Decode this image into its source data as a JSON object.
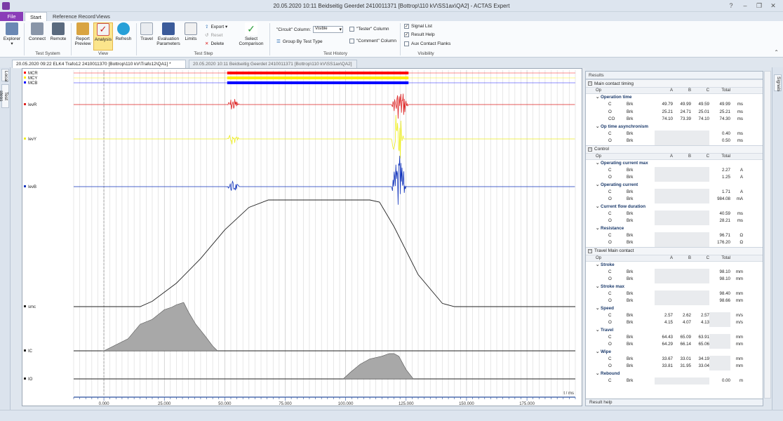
{
  "window": {
    "title": "20.05.2020 10:11 Beidseitig Geerdet 2410011371 [Bottrop\\110 kV\\SS1ax\\QA2] - ACTAS Expert"
  },
  "ribbon_tabs": [
    "File",
    "Start",
    "Reference Record",
    "Views"
  ],
  "ribbon": {
    "explorer": "Explorer",
    "connect": "Connect",
    "remote": "Remote",
    "report_preview": "Report Preview",
    "analysis": "Analysis",
    "refresh": "Refresh",
    "travel": "Travel",
    "evaluation_parameters": "Evaluation Parameters",
    "limits": "Limits",
    "export": "Export ▾",
    "reset": "Reset",
    "delete": "Delete",
    "select_comparison": "Select Comparison",
    "circuit_column_label": "\"Circuit\" Column:",
    "circuit_column_value": "Visible",
    "tester_column": "\"Tester\" Column",
    "group_by_test_type": "Group By Test Type",
    "comment_column": "\"Comment\" Column",
    "signal_list": "Signal List",
    "result_help": "Result Help",
    "aux_contact_flanks": "Aux Contact Flanks",
    "groups": [
      "Test System",
      "View",
      "Test Step",
      "Test History",
      "Visibility"
    ]
  },
  "side_tabs": {
    "left": [
      "Local",
      "Test steps"
    ],
    "right": [
      "Signals"
    ]
  },
  "doc_tabs": [
    "20.05.2020 09:22 ELK4 Trafo12 2410011370 [Bottrop\\110 kV\\Trafo12\\QA1] *",
    "20.05.2020 10:11 Beidseitig Geerdet 2410011371 [Bottrop\\110 kV\\SS1ax\\QA2]"
  ],
  "chart_data": {
    "type": "line",
    "xlabel": "t / ms",
    "x_ticks": [
      "0.000",
      "25.000",
      "50.000",
      "75.000",
      "100.000",
      "125.000",
      "150.000",
      "175.000"
    ],
    "xlim": [
      -12.5,
      195
    ],
    "series": [
      {
        "name": "MCR",
        "color": "#ff0000",
        "type": "bar",
        "on": [
          51,
          126
        ]
      },
      {
        "name": "MCY",
        "color": "#ffee00",
        "type": "bar",
        "on": [
          51,
          126
        ]
      },
      {
        "name": "MCB",
        "color": "#0000ff",
        "type": "bar",
        "on": [
          51,
          126
        ]
      },
      {
        "name": "IevR",
        "color": "#dd2222"
      },
      {
        "name": "IevY",
        "color": "#eeee22"
      },
      {
        "name": "IevB",
        "color": "#1133bb"
      },
      {
        "name": "smc",
        "color": "#222222",
        "x": [
          -12.5,
          15,
          20,
          30,
          40,
          50,
          60,
          68,
          80,
          100,
          110,
          114,
          120,
          130,
          140,
          145,
          195
        ],
        "y": [
          0,
          0,
          0.05,
          0.22,
          0.45,
          0.72,
          0.93,
          1.0,
          1.0,
          1.0,
          1.0,
          0.98,
          0.75,
          0.3,
          0.03,
          0,
          0
        ]
      },
      {
        "name": "IC",
        "color": "#222222",
        "x": [
          0,
          10,
          15,
          20,
          25,
          28,
          30,
          33,
          35,
          38,
          42,
          45,
          47,
          -1
        ],
        "y": [
          0,
          0.25,
          0.55,
          0.65,
          0.85,
          0.9,
          0.95,
          1.0,
          0.8,
          0.55,
          0.3,
          0.1,
          0,
          0
        ]
      },
      {
        "name": "IO",
        "color": "#222222",
        "x": [
          99,
          102,
          106,
          110,
          115,
          118,
          120,
          122,
          125,
          128
        ],
        "y": [
          0,
          0.25,
          0.55,
          0.75,
          0.85,
          0.95,
          0.95,
          0.85,
          0.35,
          0
        ]
      }
    ]
  },
  "results": {
    "title": "Results",
    "footer": "Result help",
    "columns": [
      "Op",
      "A",
      "B",
      "C",
      "Total"
    ],
    "sections": [
      {
        "name": "Main contact timing",
        "groups": [
          {
            "name": "Operation time",
            "rows": [
              {
                "op": "C",
                "type": "Brk",
                "a": "49.79",
                "b": "49.99",
                "c": "49.59",
                "total": "49.99",
                "unit": "ms"
              },
              {
                "op": "O",
                "type": "Brk",
                "a": "25.21",
                "b": "24.71",
                "c": "25.01",
                "total": "25.21",
                "unit": "ms"
              },
              {
                "op": "CO",
                "type": "Brk",
                "a": "74.10",
                "b": "73.39",
                "c": "74.10",
                "total": "74.30",
                "unit": "ms"
              }
            ]
          },
          {
            "name": "Op time asynchronism",
            "rows": [
              {
                "op": "C",
                "type": "Brk",
                "a": "",
                "b": "",
                "c": "",
                "total": "0.40",
                "unit": "ms"
              },
              {
                "op": "O",
                "type": "Brk",
                "a": "",
                "b": "",
                "c": "",
                "total": "0.50",
                "unit": "ms"
              }
            ]
          }
        ]
      },
      {
        "name": "Control",
        "groups": [
          {
            "name": "Operating current max",
            "rows": [
              {
                "op": "C",
                "type": "Brk",
                "a": "",
                "b": "",
                "c": "",
                "total": "2.27",
                "unit": "A"
              },
              {
                "op": "O",
                "type": "Brk",
                "a": "",
                "b": "",
                "c": "",
                "total": "1.25",
                "unit": "A"
              }
            ]
          },
          {
            "name": "Operating current",
            "rows": [
              {
                "op": "C",
                "type": "Brk",
                "a": "",
                "b": "",
                "c": "",
                "total": "1.71",
                "unit": "A"
              },
              {
                "op": "O",
                "type": "Brk",
                "a": "",
                "b": "",
                "c": "",
                "total": "984.08",
                "unit": "mA"
              }
            ]
          },
          {
            "name": "Current flow duration",
            "rows": [
              {
                "op": "C",
                "type": "Brk",
                "a": "",
                "b": "",
                "c": "",
                "total": "40.59",
                "unit": "ms"
              },
              {
                "op": "O",
                "type": "Brk",
                "a": "",
                "b": "",
                "c": "",
                "total": "28.21",
                "unit": "ms"
              }
            ]
          },
          {
            "name": "Resistance",
            "rows": [
              {
                "op": "C",
                "type": "Brk",
                "a": "",
                "b": "",
                "c": "",
                "total": "96.71",
                "unit": "Ω"
              },
              {
                "op": "O",
                "type": "Brk",
                "a": "",
                "b": "",
                "c": "",
                "total": "176.20",
                "unit": "Ω"
              }
            ]
          }
        ]
      },
      {
        "name": "Travel Main contact",
        "groups": [
          {
            "name": "Stroke",
            "rows": [
              {
                "op": "C",
                "type": "Brk",
                "a": "",
                "b": "",
                "c": "",
                "total": "98.10",
                "unit": "mm"
              },
              {
                "op": "O",
                "type": "Brk",
                "a": "",
                "b": "",
                "c": "",
                "total": "98.10",
                "unit": "mm"
              }
            ]
          },
          {
            "name": "Stroke max",
            "rows": [
              {
                "op": "C",
                "type": "Brk",
                "a": "",
                "b": "",
                "c": "",
                "total": "98.40",
                "unit": "mm"
              },
              {
                "op": "O",
                "type": "Brk",
                "a": "",
                "b": "",
                "c": "",
                "total": "98.66",
                "unit": "mm"
              }
            ]
          },
          {
            "name": "Speed",
            "rows": [
              {
                "op": "C",
                "type": "Brk",
                "a": "2.57",
                "b": "2.62",
                "c": "2.57",
                "total": "",
                "unit": "m/s"
              },
              {
                "op": "O",
                "type": "Brk",
                "a": "4.15",
                "b": "4.07",
                "c": "4.13",
                "total": "",
                "unit": "m/s"
              }
            ]
          },
          {
            "name": "Travel",
            "rows": [
              {
                "op": "C",
                "type": "Brk",
                "a": "64.43",
                "b": "65.09",
                "c": "63.91",
                "total": "",
                "unit": "mm"
              },
              {
                "op": "O",
                "type": "Brk",
                "a": "64.29",
                "b": "66.14",
                "c": "65.06",
                "total": "",
                "unit": "mm"
              }
            ]
          },
          {
            "name": "Wipe",
            "rows": [
              {
                "op": "C",
                "type": "Brk",
                "a": "33.67",
                "b": "33.01",
                "c": "34.19",
                "total": "",
                "unit": "mm"
              },
              {
                "op": "O",
                "type": "Brk",
                "a": "33.81",
                "b": "31.95",
                "c": "33.04",
                "total": "",
                "unit": "mm"
              }
            ]
          },
          {
            "name": "Rebound",
            "rows": [
              {
                "op": "C",
                "type": "Brk",
                "a": "",
                "b": "",
                "c": "",
                "total": "0.00",
                "unit": "m"
              }
            ]
          }
        ]
      }
    ]
  }
}
